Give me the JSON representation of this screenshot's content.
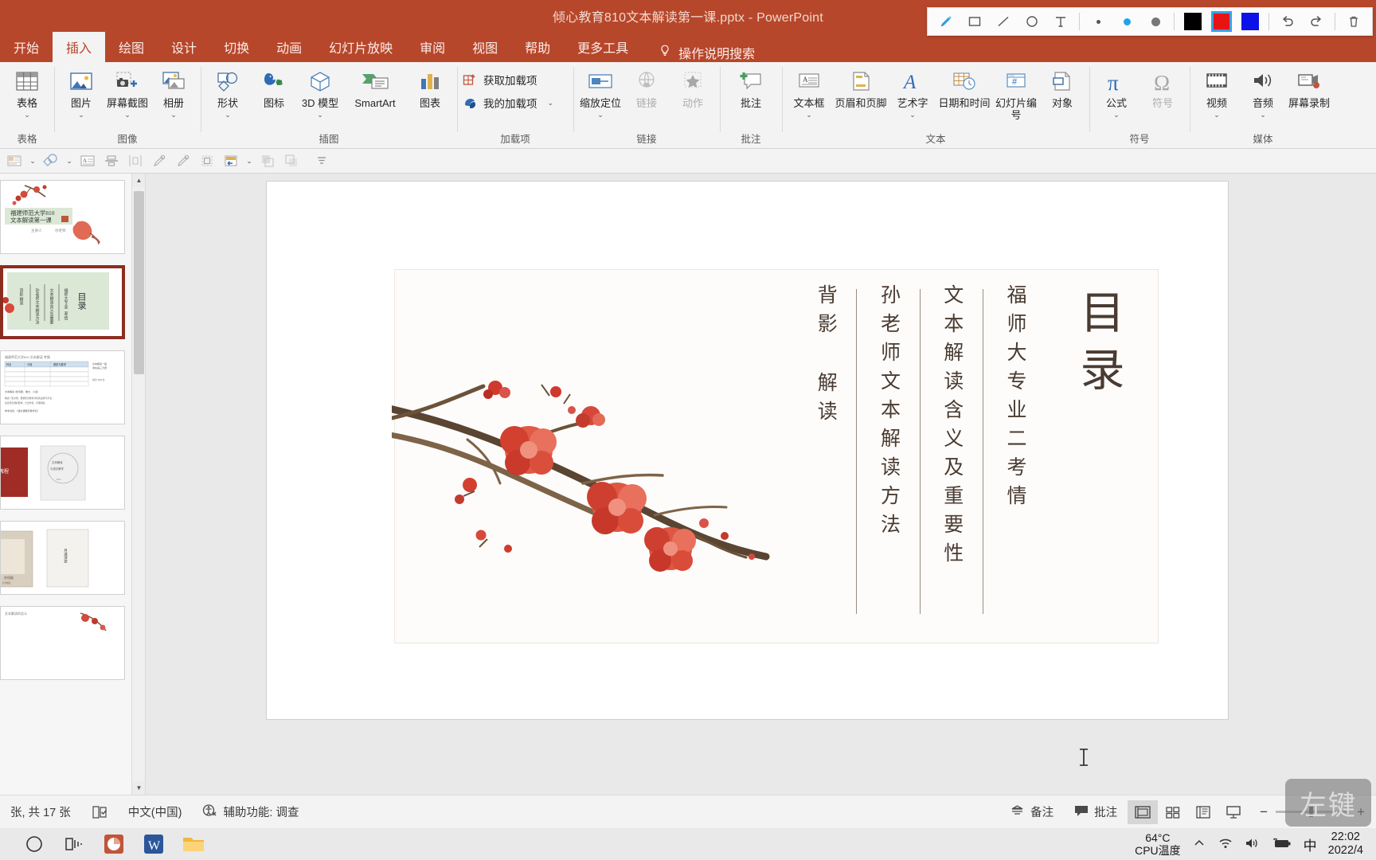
{
  "titlebar": {
    "title": "倾心教育810文本解读第一课.pptx  -  PowerPoint"
  },
  "annotation_toolbar": {
    "tools": [
      {
        "name": "pen-icon",
        "glyph": "✏"
      },
      {
        "name": "rectangle-icon",
        "glyph": "▭"
      },
      {
        "name": "line-icon",
        "glyph": "╱"
      },
      {
        "name": "ellipse-icon",
        "glyph": "◯"
      },
      {
        "name": "text-icon",
        "glyph": "T"
      }
    ],
    "sizes": [
      "small",
      "medium",
      "large"
    ],
    "colors": [
      "#000000",
      "#e81313",
      "#0a12e8"
    ],
    "selected_color": "#e81313",
    "undo": "undo-icon",
    "redo": "redo-icon",
    "delete": "trash-icon"
  },
  "tabs": [
    {
      "label": "开始",
      "active": false
    },
    {
      "label": "插入",
      "active": true
    },
    {
      "label": "绘图",
      "active": false
    },
    {
      "label": "设计",
      "active": false
    },
    {
      "label": "切换",
      "active": false
    },
    {
      "label": "动画",
      "active": false
    },
    {
      "label": "幻灯片放映",
      "active": false
    },
    {
      "label": "审阅",
      "active": false
    },
    {
      "label": "视图",
      "active": false
    },
    {
      "label": "帮助",
      "active": false
    },
    {
      "label": "更多工具",
      "active": false
    }
  ],
  "tell_me": {
    "label": "操作说明搜索"
  },
  "ribbon": {
    "groups": [
      {
        "title": "表格",
        "buttons": [
          {
            "label": "表格",
            "icon": "table-icon",
            "caret": true
          }
        ]
      },
      {
        "title": "图像",
        "buttons": [
          {
            "label": "图片",
            "icon": "picture-icon",
            "caret": true
          },
          {
            "label": "屏幕截图",
            "icon": "screenshot-icon",
            "caret": true
          },
          {
            "label": "相册",
            "icon": "photo-album-icon",
            "caret": true
          }
        ]
      },
      {
        "title": "插图",
        "buttons": [
          {
            "label": "形状",
            "icon": "shapes-icon",
            "caret": true
          },
          {
            "label": "图标",
            "icon": "icons-icon",
            "caret": false
          },
          {
            "label": "3D 模型",
            "icon": "model3d-icon",
            "caret": true
          },
          {
            "label": "SmartArt",
            "icon": "smartart-icon",
            "caret": false
          },
          {
            "label": "图表",
            "icon": "chart-icon",
            "caret": false
          }
        ]
      },
      {
        "title": "加载项",
        "small_buttons": [
          {
            "label": "获取加载项",
            "icon": "get-addins-icon",
            "caret": false
          },
          {
            "label": "我的加载项",
            "icon": "my-addins-icon",
            "caret": true
          }
        ]
      },
      {
        "title": "链接",
        "buttons": [
          {
            "label": "缩放定位",
            "icon": "zoom-locate-icon",
            "caret": true
          },
          {
            "label": "链接",
            "icon": "link-icon",
            "caret": false,
            "disabled": true
          },
          {
            "label": "动作",
            "icon": "action-icon",
            "caret": false,
            "disabled": true
          }
        ]
      },
      {
        "title": "批注",
        "buttons": [
          {
            "label": "批注",
            "icon": "comment-icon",
            "caret": false
          }
        ]
      },
      {
        "title": "文本",
        "buttons": [
          {
            "label": "文本框",
            "icon": "textbox-icon",
            "caret": true
          },
          {
            "label": "页眉和页脚",
            "icon": "header-footer-icon",
            "caret": false
          },
          {
            "label": "艺术字",
            "icon": "wordart-icon",
            "caret": true
          },
          {
            "label": "日期和时间",
            "icon": "datetime-icon",
            "caret": false
          },
          {
            "label": "幻灯片编号",
            "icon": "slide-number-icon",
            "caret": false
          },
          {
            "label": "对象",
            "icon": "object-icon",
            "caret": false
          }
        ]
      },
      {
        "title": "符号",
        "buttons": [
          {
            "label": "公式",
            "icon": "equation-icon",
            "caret": true
          },
          {
            "label": "符号",
            "icon": "symbol-icon",
            "caret": false,
            "disabled": true
          }
        ]
      },
      {
        "title": "媒体",
        "buttons": [
          {
            "label": "视频",
            "icon": "video-icon",
            "caret": true
          },
          {
            "label": "音频",
            "icon": "audio-icon",
            "caret": true
          },
          {
            "label": "屏幕录制",
            "icon": "screen-record-icon",
            "caret": false
          }
        ]
      }
    ]
  },
  "quick_toolbar": {
    "items": [
      "insert-placeholder-icon",
      "caret",
      "shapes-merge-icon",
      "caret",
      "text-format-icon",
      "align-center-icon",
      "distribute-icon",
      "eyedropper-icon",
      "eyedropper-alt-icon",
      "select-objects-icon",
      "replace-icon",
      "caret",
      "bring-front-icon",
      "send-back-icon",
      "more-icon"
    ]
  },
  "slide_panel": {
    "slides": [
      {
        "number": 1,
        "selected": false,
        "kind": "title-slide",
        "title_lines": [
          "福建师范大学810",
          "文本解读第一课"
        ]
      },
      {
        "number": 2,
        "selected": true,
        "kind": "toc-slide",
        "toc_title": "目录"
      },
      {
        "number": 3,
        "selected": false,
        "kind": "table-slide"
      },
      {
        "number": 4,
        "selected": false,
        "kind": "two-image-slide"
      },
      {
        "number": 5,
        "selected": false,
        "kind": "two-image-slide"
      },
      {
        "number": 6,
        "selected": false,
        "kind": "blossom-slide"
      }
    ]
  },
  "slide": {
    "toc_title": "目录",
    "columns": [
      {
        "text": "背影 解读",
        "raw": "背影  解读"
      },
      {
        "text": "孙老师文本解读方法"
      },
      {
        "text": "文本解读含义及重要性"
      },
      {
        "text": "福师大专业二考情"
      }
    ],
    "artwork": "plum-blossom-branch"
  },
  "statusbar": {
    "slide_count": "张, 共 17 张",
    "language": "中文(中国)",
    "accessibility": "辅助功能: 调查",
    "notes": "备注",
    "comments": "批注",
    "views": [
      {
        "name": "normal-view",
        "active": true
      },
      {
        "name": "slide-sorter-view",
        "active": false
      },
      {
        "name": "reading-view",
        "active": false
      },
      {
        "name": "slideshow-view",
        "active": false
      }
    ],
    "zoom_out": "−",
    "zoom_in": "+"
  },
  "taskbar": {
    "apps": [
      {
        "name": "cortana-icon"
      },
      {
        "name": "task-view-icon"
      },
      {
        "name": "powerpoint-icon"
      },
      {
        "name": "word-icon"
      },
      {
        "name": "file-explorer-icon"
      }
    ],
    "cpu_temp": "64°C",
    "cpu_label": "CPU温度",
    "tray": [
      "chevron-up-icon",
      "wifi-icon",
      "volume-icon",
      "battery-icon"
    ],
    "ime": "中",
    "time": "22:02",
    "date": "2022/4"
  },
  "click_hint": {
    "label": "左键"
  },
  "theme": {
    "accent": "#b7472a",
    "slide_text": "#4a3b32",
    "selection": "#8c2d1f"
  }
}
